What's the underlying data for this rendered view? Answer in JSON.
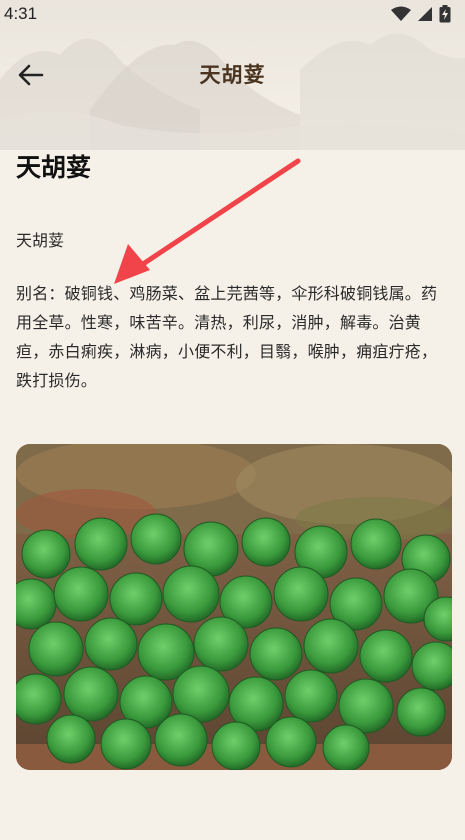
{
  "status_bar": {
    "time": "4:31"
  },
  "app_bar": {
    "title": "天胡荽"
  },
  "herb": {
    "name": "天胡荽",
    "subname": "天胡荽",
    "description": "别名：破铜钱、鸡肠菜、盆上芫茜等，伞形科破铜钱属。药用全草。性寒，味苦辛。清热，利尿，消肿，解毒。治黄疸，赤白痢疾，淋病，小便不利，目翳，喉肿，痈疽疔疮，跌打损伤。"
  },
  "colors": {
    "background": "#f6f1e8",
    "title_brown": "#4a3420",
    "annotation_arrow": "#f0444a"
  }
}
